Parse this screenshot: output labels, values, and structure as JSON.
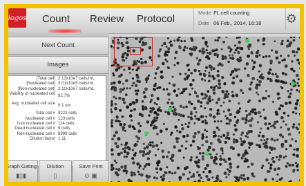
{
  "app": {
    "logo_text": "logos",
    "nav": {
      "count": "Count",
      "review": "Review",
      "protocol": "Protocol"
    },
    "mode_key": "Mode",
    "mode_value": "FL cell counting",
    "date_key": "Date",
    "date_value": "06 Feb., 2014, 16:18"
  },
  "left_panel": {
    "next_count": "Next Count",
    "images": "Images",
    "results": [
      {
        "label": "[Total cell]",
        "value": "2.13x10e7 cells/mL"
      },
      {
        "label": "[Nucleated cell]",
        "value": "3.01x10e5 cells/mL"
      },
      {
        "label": "[Non-nucleated cell]",
        "value": "2.10x10e7 cells/mL"
      },
      {
        "label": "Viability of nucleated cell",
        "value": "92.7%",
        "tall": true
      },
      {
        "label": "Avg. nucleated cell size",
        "value": "9.1 um",
        "tall": true
      },
      {
        "label": "Total cell #",
        "value": "9222 cells"
      },
      {
        "label": "Nucleated cell #",
        "value": "123 cells"
      },
      {
        "label": "Live nucleated cell #",
        "value": "114 cells"
      },
      {
        "label": "Dead nucleated cell #",
        "value": "9 cells"
      },
      {
        "label": "Non-nucleated cell #",
        "value": "8999 cells"
      },
      {
        "label": "Dilution factor",
        "value": "1.11"
      }
    ],
    "buttons": {
      "graph": "Graph Gating",
      "dilution": "Dilution",
      "save": "Save Print"
    }
  },
  "colors": {
    "frame": "#f2c400",
    "accent_red": "#d21f26",
    "cell_dark": "#2a2a2a",
    "cell_green": "#3fd15a"
  }
}
